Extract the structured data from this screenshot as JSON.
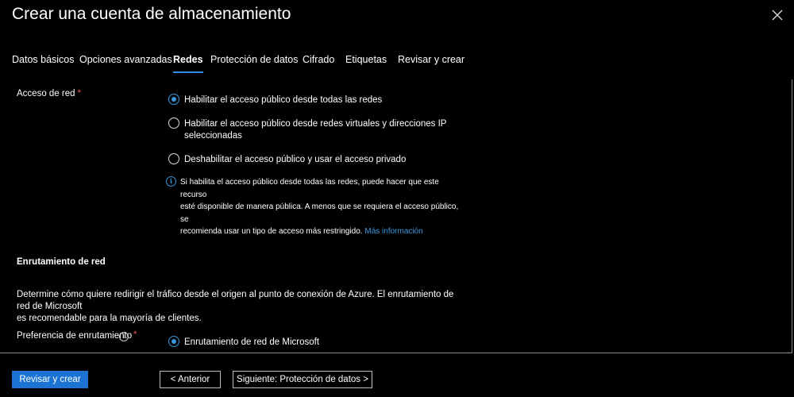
{
  "header": {
    "title": "Crear una cuenta de almacenamiento",
    "more_label": "···",
    "close_icon": "close-icon"
  },
  "tabs": [
    {
      "label": "Datos básicos",
      "active": false
    },
    {
      "label": "Opciones avanzadas",
      "active": false
    },
    {
      "label": "Redes",
      "active": true
    },
    {
      "label": "Protección de datos",
      "active": false
    },
    {
      "label": "Cifrado",
      "active": false
    },
    {
      "label": "Etiquetas",
      "active": false
    },
    {
      "label": "Revisar y crear",
      "active": false
    }
  ],
  "network_access": {
    "label": "Acceso de red",
    "required_mark": "*",
    "options": [
      {
        "text": "Habilitar el acceso público desde todas las redes",
        "selected": true
      },
      {
        "text_line1": "Habilitar el acceso público desde redes virtuales y direcciones IP",
        "text_line2": "seleccionadas",
        "selected": false
      },
      {
        "text": "Deshabilitar el acceso público y usar el acceso privado",
        "selected": false
      }
    ],
    "info": {
      "icon": "info-icon",
      "line1": "Si habilita el acceso público desde todas las redes, puede hacer que este recurso",
      "line2": "esté disponible de manera pública. A menos que se requiera el acceso público, se",
      "line3": "recomienda usar un tipo de acceso más restringido.",
      "link": "Más información"
    }
  },
  "routing": {
    "title": "Enrutamiento de red",
    "description_line1": "Determine cómo quiere redirigir el tráfico desde el origen al punto de conexión de Azure. El enrutamiento de red de Microsoft",
    "description_line2": "es recomendable para la mayoría de clientes.",
    "preference_label": "Preferencia de enrutamiento",
    "info_icon": "info-icon",
    "required_mark": "*",
    "option": {
      "text": "Enrutamiento de red de Microsoft",
      "selected": true
    }
  },
  "footer": {
    "review_create": "Revisar y crear",
    "previous": "< Anterior",
    "next": "Siguiente: Protección de datos >"
  },
  "colors": {
    "accent": "#3a96dd",
    "primary_button": "#1b73d4",
    "background": "#000000",
    "required": "#e05a5a"
  }
}
